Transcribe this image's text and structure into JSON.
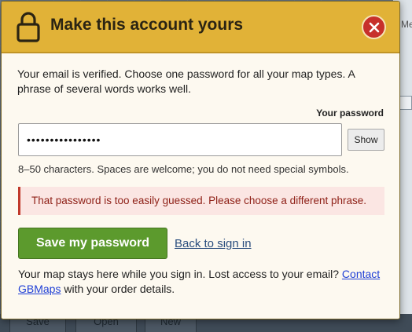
{
  "background": {
    "tab_label": "Mes",
    "toolbar": {
      "save_label": "Save",
      "open_label": "Open",
      "new_label": "New"
    }
  },
  "dialog": {
    "title": "Make this account yours",
    "header_icon": "padlock-icon",
    "close_icon": "close-icon",
    "intro": "Your email is verified. Choose one password for all your map types. A phrase of several words works well.",
    "password_label": "Your password",
    "password_value": "••••••••••••••••",
    "show_button_label": "Show",
    "hint": "8–50 characters. Spaces are welcome; you do not need special symbols.",
    "error_message": "That password is too easily guessed. Please choose a different phrase.",
    "save_button_label": "Save my password",
    "back_link_label": "Back to sign in",
    "footer_text": "Your map stays here while you sign in. Lost access to your email?",
    "footer_link_label": "Contact GBMaps",
    "footer_text_end": "with your order details."
  },
  "colors": {
    "header_bg": "#e1b237",
    "close_button_bg": "#c7302b",
    "save_button_bg": "#5c9a2d",
    "error_border": "#c0392b",
    "error_bg": "#fbe6e3",
    "link": "#1f3fd6"
  }
}
